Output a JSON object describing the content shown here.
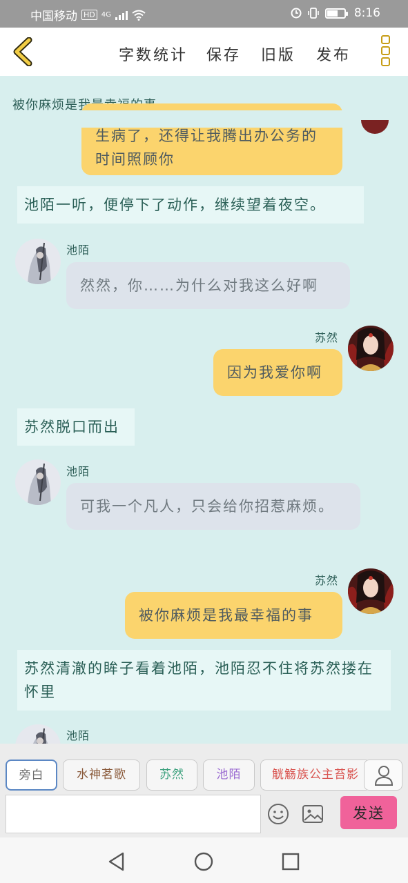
{
  "status_bar": {
    "carrier": "中国移动",
    "hd": "HD",
    "network": "4G",
    "time": "8:16"
  },
  "toolbar": {
    "word_count": "字数统计",
    "save": "保存",
    "old_version": "旧版",
    "publish": "发布"
  },
  "chat": {
    "title": "被你麻烦是我最幸福的事",
    "messages": [
      {
        "kind": "self",
        "speaker": "",
        "text": "生病了，还得让我腾出办公务的时间照顾你"
      },
      {
        "kind": "narration",
        "text": "池陌一听，便停下了动作，继续望着夜空。"
      },
      {
        "kind": "other",
        "speaker": "池陌",
        "text": "然然，你……为什么对我这么好啊"
      },
      {
        "kind": "self",
        "speaker": "苏然",
        "text": "因为我爱你啊"
      },
      {
        "kind": "narration",
        "text": "苏然脱口而出"
      },
      {
        "kind": "other",
        "speaker": "池陌",
        "text": "可我一个凡人，只会给你招惹麻烦。"
      },
      {
        "kind": "self",
        "speaker": "苏然",
        "text": "被你麻烦是我最幸福的事"
      },
      {
        "kind": "narration",
        "text": "苏然清澈的眸子看着池陌，池陌忍不住将苏然搂在怀里"
      },
      {
        "kind": "other",
        "speaker": "池陌",
        "text": ""
      }
    ]
  },
  "composer": {
    "roles": [
      {
        "label": "旁白",
        "color": "#6d6d6d"
      },
      {
        "label": "水神茗歌",
        "color": "#8a5a3a"
      },
      {
        "label": "苏然",
        "color": "#3aa07c"
      },
      {
        "label": "池陌",
        "color": "#9b6bd1"
      },
      {
        "label": "觥觞族公主苔影",
        "color": "#d9534f"
      }
    ],
    "input_placeholder": "",
    "send_label": "发送"
  }
}
